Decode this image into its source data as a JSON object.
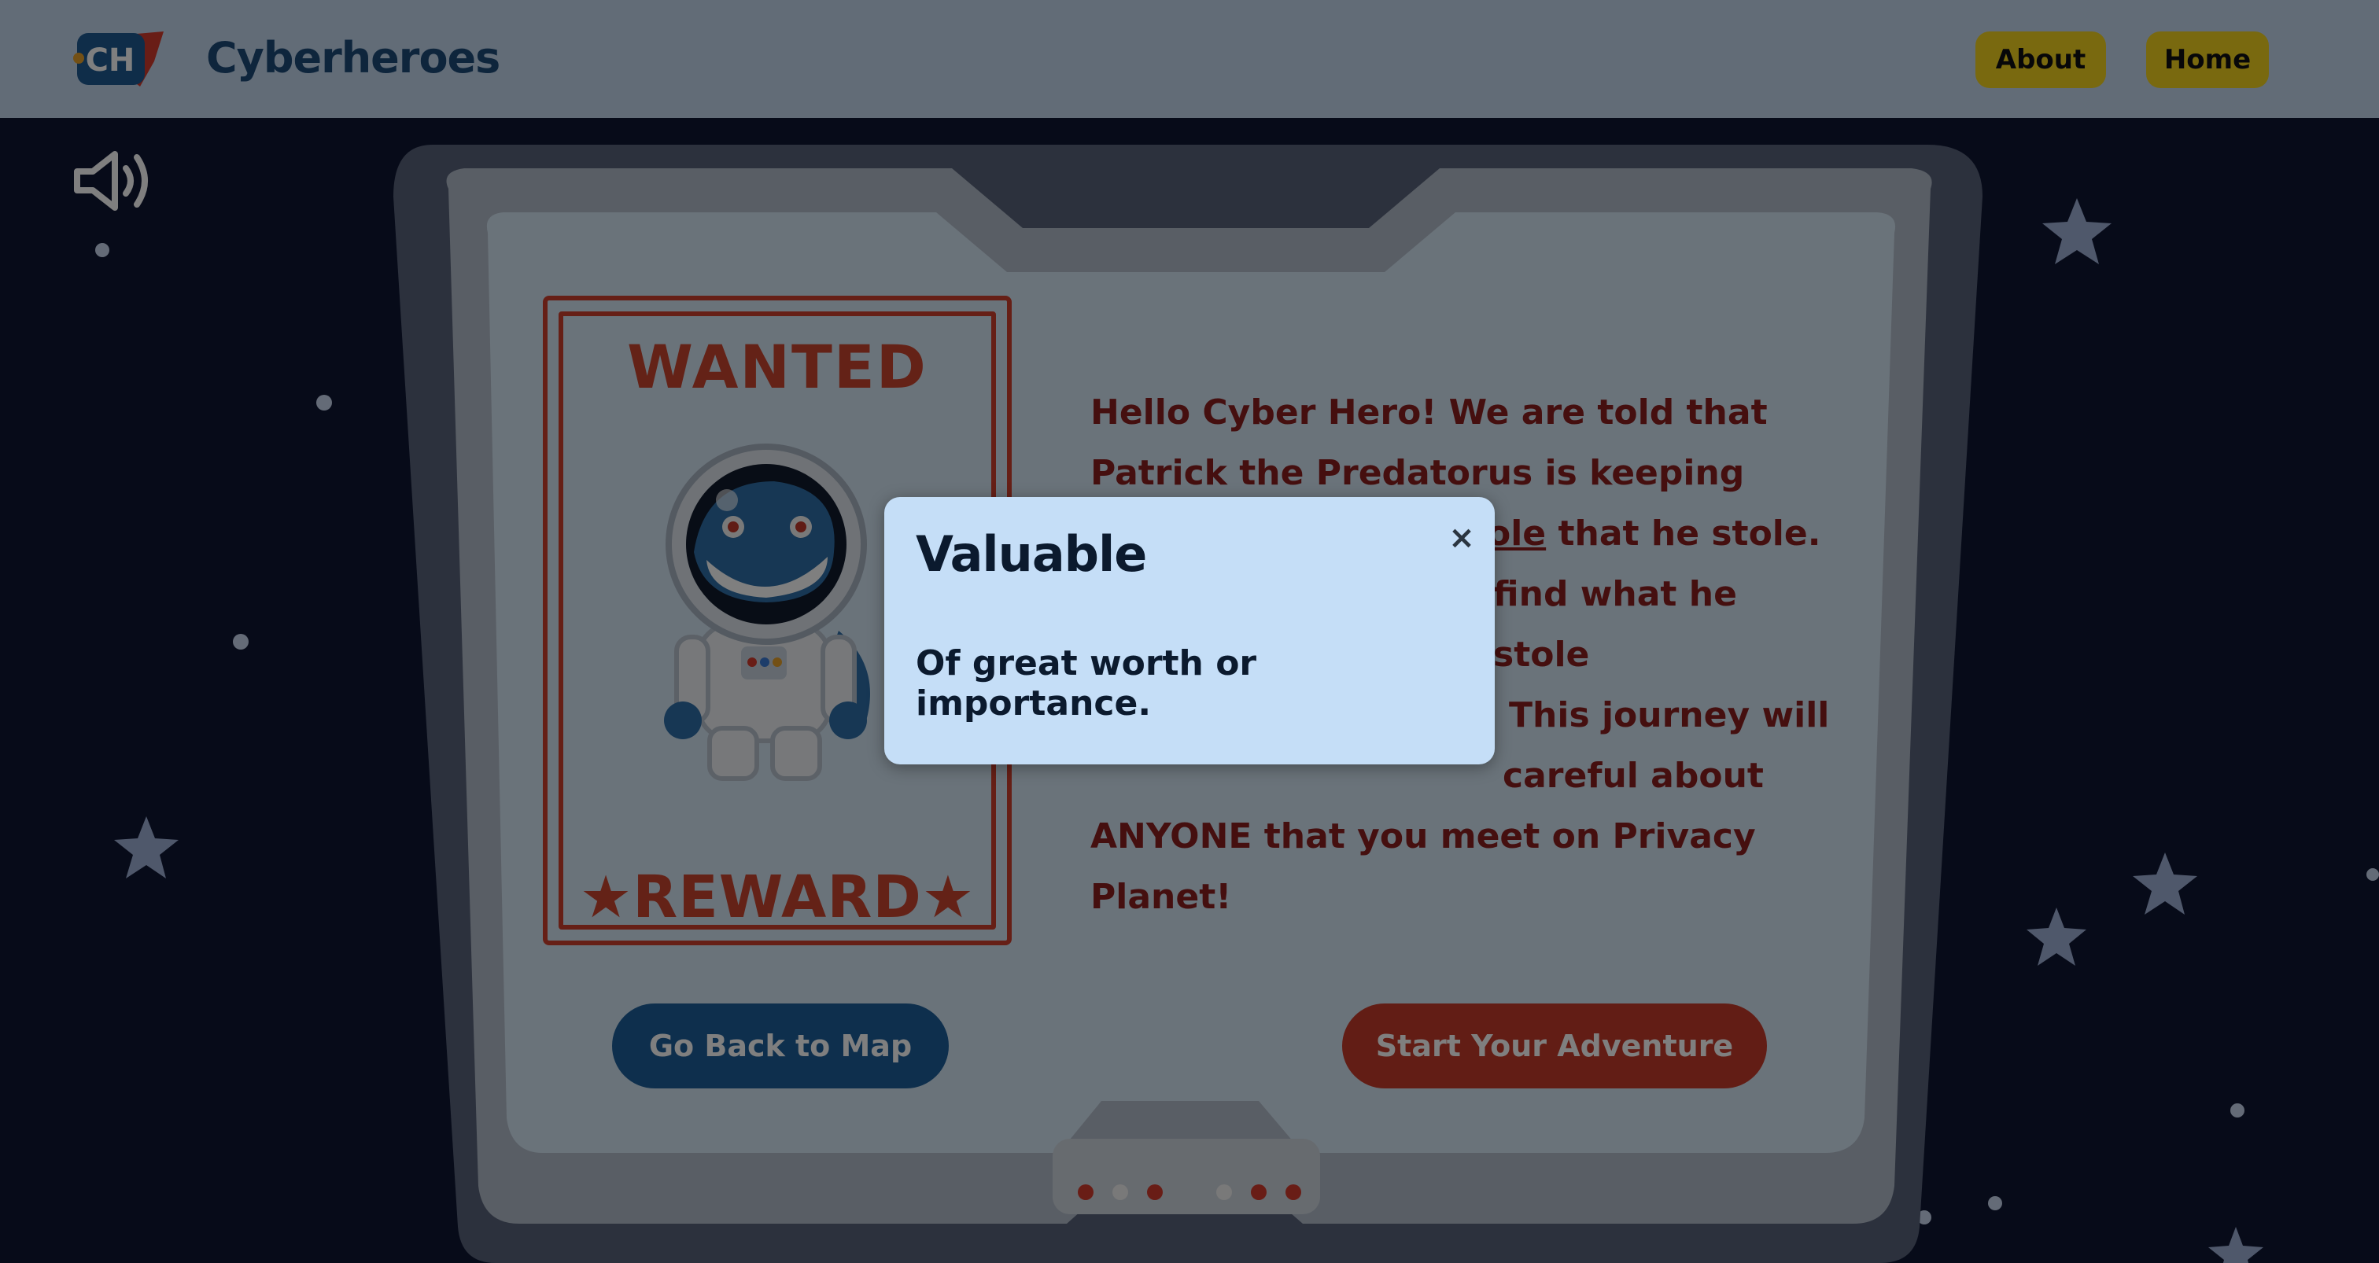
{
  "header": {
    "brand": "Cyberheroes",
    "nav": [
      {
        "label": "About"
      },
      {
        "label": "Home"
      }
    ]
  },
  "icons": {
    "logo": "cyberheroes-logo-icon",
    "sound": "speaker-volume-icon",
    "close": "close-icon"
  },
  "poster": {
    "top_text": "WANTED",
    "bottom_text": "★REWARD★"
  },
  "story": {
    "line1": "Hello Cyber Hero! We are told that",
    "line2": "Patrick the Predatorus is keeping",
    "line3_word": "ole",
    "line3_rest": " that he stole.",
    "line4": "find what he stole",
    "line5": ". This journey will",
    "line6": "careful about",
    "line7": "ANYONE that you meet on Privacy",
    "line8": "Planet!"
  },
  "actions": {
    "back_label": "Go Back to Map",
    "start_label": "Start Your Adventure"
  },
  "modal": {
    "title": "Valuable",
    "close_glyph": "×",
    "definition": "Of great worth or importance."
  },
  "colors": {
    "nav_button": "#f2d21e",
    "back_button": "#1d5f9a",
    "start_button": "#c43a2b",
    "story_text": "#8a1f1f",
    "modal_bg": "#c5def7"
  }
}
